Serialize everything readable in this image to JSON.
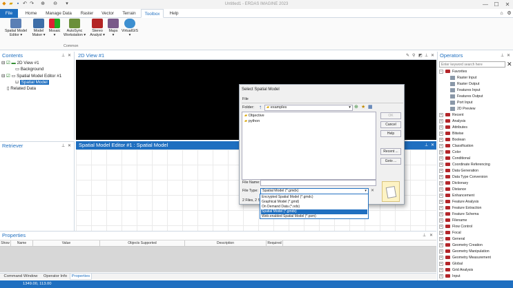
{
  "app": {
    "title": "Untitled1 - ERDAS IMAGINE 2023",
    "status_coords": "1349.00, 113.00"
  },
  "quick_access": {
    "icons": [
      "app-logo-icon",
      "open-folder-icon",
      "save-icon",
      "undo-icon",
      "redo-icon",
      "zoom-in-icon",
      "zoom-out-icon",
      "customize-icon"
    ]
  },
  "window_controls": {
    "minimize": "—",
    "maximize": "☐",
    "close": "✕"
  },
  "ribbon": {
    "tabs": [
      {
        "label": "File"
      },
      {
        "label": "Home"
      },
      {
        "label": "Manage Data"
      },
      {
        "label": "Raster"
      },
      {
        "label": "Vector"
      },
      {
        "label": "Terrain"
      },
      {
        "label": "Toolbox"
      },
      {
        "label": "Help"
      }
    ],
    "active_tab": "Toolbox",
    "buttons": [
      {
        "line1": "Spatial Model",
        "line2": "Editor ▾"
      },
      {
        "line1": "Model",
        "line2": "Maker ▾"
      },
      {
        "line1": "Mosaic",
        "line2": "▾"
      },
      {
        "line1": "AutoSync",
        "line2": "Workstation ▾"
      },
      {
        "line1": "Stereo",
        "line2": "Analyst ▾"
      },
      {
        "line1": "Maps",
        "line2": "▾"
      },
      {
        "line1": "VirtualGIS",
        "line2": "▾"
      }
    ],
    "group_label": "Common"
  },
  "contents": {
    "title": "Contents",
    "items": [
      {
        "label": "2D View #1"
      },
      {
        "label": "Background"
      },
      {
        "label": "Spatial Model Editor #1"
      },
      {
        "label": "Spatial Model"
      },
      {
        "label": "Related Data"
      }
    ]
  },
  "view": {
    "title": "2D View #1"
  },
  "retriever": {
    "title": "Retriever"
  },
  "model_editor": {
    "title": "Spatial Model Editor #1 : Spatial Model"
  },
  "dialog": {
    "title": "Select Spatial Model",
    "menu": "File",
    "folder_label": "Folder:",
    "folder_value": "examples",
    "files": [
      {
        "name": "Objective"
      },
      {
        "name": "python"
      }
    ],
    "buttons": {
      "ok": "OK",
      "cancel": "Cancel",
      "help": "Help",
      "recent": "Recent ...",
      "goto": "Goto ..."
    },
    "file_name_label": "File Name:",
    "file_name_value": "",
    "file_type_label": "File Type:",
    "file_type_value": "Spatial Model (*.gmdx)",
    "summary": "2 Files, 2 Sub",
    "file_types": [
      {
        "label": "Encrypted Spatial Model (*.gmdc)"
      },
      {
        "label": "Graphical Model (*.gmd)"
      },
      {
        "label": "On Demand Data (*.ods)"
      },
      {
        "label": "Spatial Model (*.gmdx)"
      },
      {
        "label": "Web-enabled Spatial Model (*.psm)"
      }
    ],
    "selected_type_index": 3
  },
  "operators": {
    "title": "Operators",
    "search_placeholder": "Enter keyword search here",
    "favorites": {
      "label": "Favorites",
      "children": [
        {
          "label": "Raster Input"
        },
        {
          "label": "Raster Output"
        },
        {
          "label": "Features Input"
        },
        {
          "label": "Features Output"
        },
        {
          "label": "Port Input"
        },
        {
          "label": "2D Preview"
        }
      ]
    },
    "categories": [
      {
        "label": "Recent"
      },
      {
        "label": "Analysis"
      },
      {
        "label": "Attributes"
      },
      {
        "label": "Bitwise"
      },
      {
        "label": "Boolean"
      },
      {
        "label": "Classification"
      },
      {
        "label": "Color"
      },
      {
        "label": "Conditional"
      },
      {
        "label": "Coordinate Referencing"
      },
      {
        "label": "Data Generation"
      },
      {
        "label": "Data Type Conversion"
      },
      {
        "label": "Dictionary"
      },
      {
        "label": "Distance"
      },
      {
        "label": "Enhancement"
      },
      {
        "label": "Feature Analysis"
      },
      {
        "label": "Feature Extraction"
      },
      {
        "label": "Feature Schema"
      },
      {
        "label": "Filename"
      },
      {
        "label": "Flow Control"
      },
      {
        "label": "Focal"
      },
      {
        "label": "General"
      },
      {
        "label": "Geometry Creation"
      },
      {
        "label": "Geometry Manipulation"
      },
      {
        "label": "Geometry Measurement"
      },
      {
        "label": "Global"
      },
      {
        "label": "Grid Analysis"
      },
      {
        "label": "Input"
      }
    ]
  },
  "properties": {
    "title": "Properties",
    "columns": [
      {
        "label": "Show"
      },
      {
        "label": "Name"
      },
      {
        "label": "Value"
      },
      {
        "label": "Objects Supported"
      },
      {
        "label": "Description"
      },
      {
        "label": "Required"
      }
    ]
  },
  "bottom_tabs": [
    {
      "label": "Command Window"
    },
    {
      "label": "Operator Info"
    },
    {
      "label": "Properties"
    }
  ],
  "active_bottom_tab": "Properties"
}
